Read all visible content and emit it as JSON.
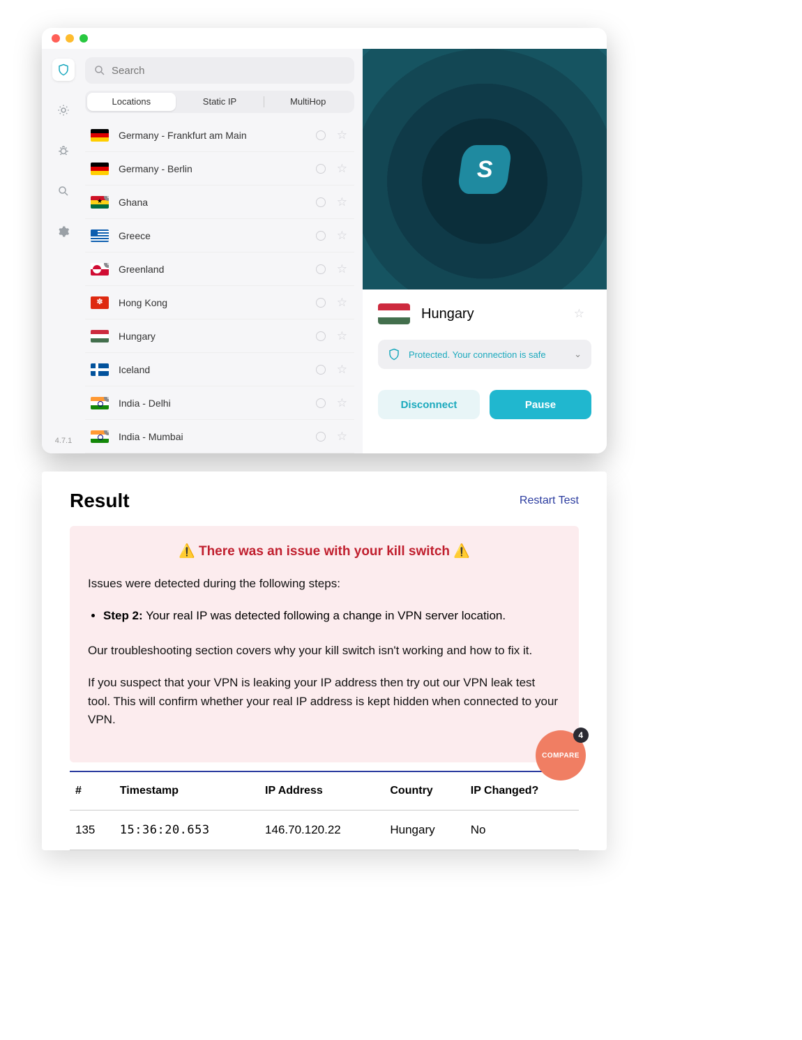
{
  "app": {
    "version": "4.7.1",
    "search_placeholder": "Search",
    "tabs": {
      "locations": "Locations",
      "static": "Static IP",
      "multihop": "MultiHop"
    },
    "locations": [
      {
        "name": "Germany - Frankfurt am Main",
        "flag": "flag-de"
      },
      {
        "name": "Germany - Berlin",
        "flag": "flag-de"
      },
      {
        "name": "Ghana",
        "flag": "flag-gh",
        "virtual": true
      },
      {
        "name": "Greece",
        "flag": "flag-gr"
      },
      {
        "name": "Greenland",
        "flag": "flag-gl",
        "virtual": true
      },
      {
        "name": "Hong Kong",
        "flag": "flag-hk"
      },
      {
        "name": "Hungary",
        "flag": "flag-hu"
      },
      {
        "name": "Iceland",
        "flag": "flag-is"
      },
      {
        "name": "India - Delhi",
        "flag": "flag-in",
        "virtual": true
      },
      {
        "name": "India - Mumbai",
        "flag": "flag-in",
        "virtual": true
      }
    ],
    "connection": {
      "country": "Hungary",
      "status": "Protected. Your connection is safe",
      "disconnect": "Disconnect",
      "pause": "Pause"
    }
  },
  "result": {
    "title": "Result",
    "restart": "Restart Test",
    "alert_title": "⚠️ There was an issue with your kill switch ⚠️",
    "issues_intro": "Issues were detected during the following steps:",
    "step_label": "Step 2:",
    "step_text": " Your real IP was detected following a change in VPN server location.",
    "trouble": "Our troubleshooting section covers why your kill switch isn't working and how to fix it.",
    "leak": "If you suspect that your VPN is leaking your IP address then try out our VPN leak test tool. This will confirm whether your real IP address is kept hidden when connected to your VPN.",
    "columns": {
      "num": "#",
      "ts": "Timestamp",
      "ip": "IP Address",
      "country": "Country",
      "changed": "IP Changed?"
    },
    "row": {
      "num": "135",
      "ts": "15:36:20.653",
      "ip": "146.70.120.22",
      "country": "Hungary",
      "changed": "No"
    },
    "compare": {
      "label": "COMPARE",
      "count": "4"
    }
  }
}
